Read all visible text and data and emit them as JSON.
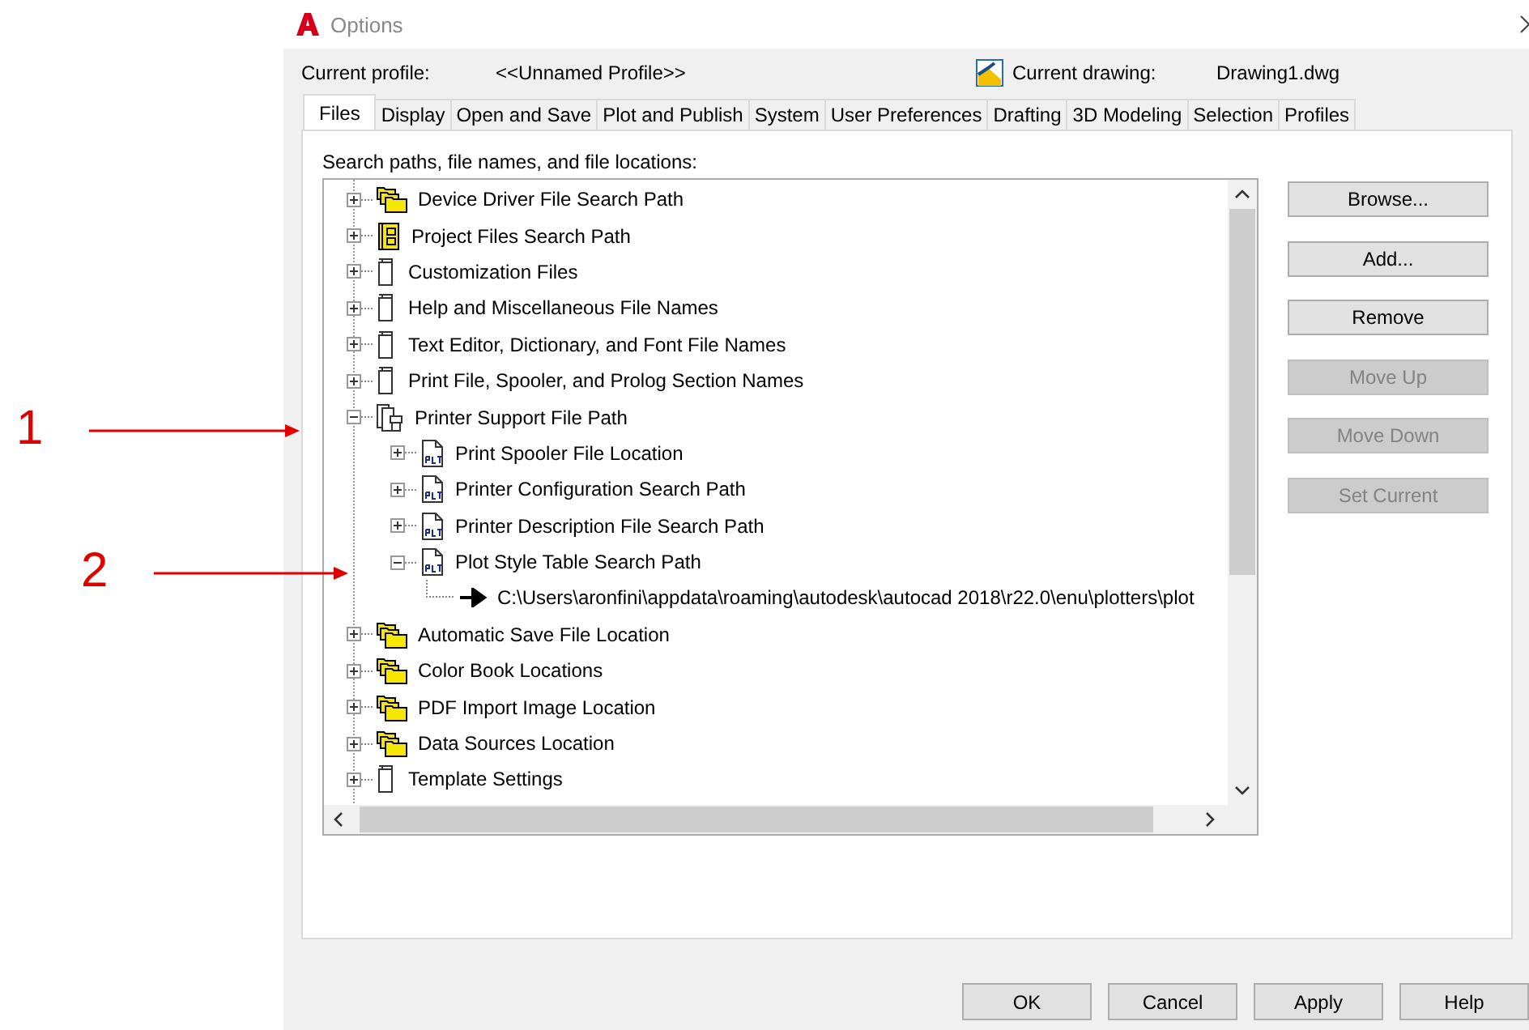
{
  "window": {
    "title": "Options"
  },
  "annotations": [
    {
      "label": "1"
    },
    {
      "label": "2"
    }
  ],
  "profile": {
    "label": "Current profile:",
    "value": "<<Unnamed Profile>>",
    "drawing_label": "Current drawing:",
    "drawing_value": "Drawing1.dwg"
  },
  "tabs": [
    {
      "label": "Files",
      "selected": true
    },
    {
      "label": "Display",
      "selected": false
    },
    {
      "label": "Open and Save",
      "selected": false
    },
    {
      "label": "Plot and Publish",
      "selected": false
    },
    {
      "label": "System",
      "selected": false
    },
    {
      "label": "User Preferences",
      "selected": false
    },
    {
      "label": "Drafting",
      "selected": false
    },
    {
      "label": "3D Modeling",
      "selected": false
    },
    {
      "label": "Selection",
      "selected": false
    },
    {
      "label": "Profiles",
      "selected": false
    }
  ],
  "tree_label": "Search paths, file names, and file locations:",
  "tree": [
    {
      "kind": "folder",
      "label": "Device Driver File Search Path",
      "expanded": false
    },
    {
      "kind": "project",
      "label": "Project Files Search Path",
      "expanded": false
    },
    {
      "kind": "file",
      "label": "Customization Files",
      "expanded": false
    },
    {
      "kind": "file",
      "label": "Help and Miscellaneous File Names",
      "expanded": false
    },
    {
      "kind": "file",
      "label": "Text Editor, Dictionary, and Font File Names",
      "expanded": false
    },
    {
      "kind": "file",
      "label": "Print File, Spooler, and Prolog Section Names",
      "expanded": false
    },
    {
      "kind": "printer",
      "label": "Printer Support File Path",
      "expanded": true,
      "children": [
        {
          "kind": "plt",
          "label": "Print Spooler File Location",
          "expanded": false
        },
        {
          "kind": "plt",
          "label": "Printer Configuration Search Path",
          "expanded": false
        },
        {
          "kind": "plt",
          "label": "Printer Description File Search Path",
          "expanded": false
        },
        {
          "kind": "plt",
          "label": "Plot Style Table Search Path",
          "expanded": true,
          "children": [
            {
              "kind": "path",
              "label": "C:\\Users\\aronfini\\appdata\\roaming\\autodesk\\autocad 2018\\r22.0\\enu\\plotters\\plot"
            }
          ]
        }
      ]
    },
    {
      "kind": "folder",
      "label": "Automatic Save File Location",
      "expanded": false
    },
    {
      "kind": "folder",
      "label": "Color Book Locations",
      "expanded": false
    },
    {
      "kind": "folder",
      "label": "PDF Import Image Location",
      "expanded": false
    },
    {
      "kind": "folder",
      "label": "Data Sources Location",
      "expanded": false
    },
    {
      "kind": "file",
      "label": "Template Settings",
      "expanded": false
    }
  ],
  "side_buttons": [
    {
      "label": "Browse...",
      "disabled": false
    },
    {
      "label": "Add...",
      "disabled": false
    },
    {
      "label": "Remove",
      "disabled": false
    },
    {
      "label": "Move Up",
      "disabled": true
    },
    {
      "label": "Move Down",
      "disabled": true
    },
    {
      "label": "Set Current",
      "disabled": true
    }
  ],
  "buttons": [
    {
      "label": "OK"
    },
    {
      "label": "Cancel"
    },
    {
      "label": "Apply"
    },
    {
      "label": "Help"
    }
  ]
}
